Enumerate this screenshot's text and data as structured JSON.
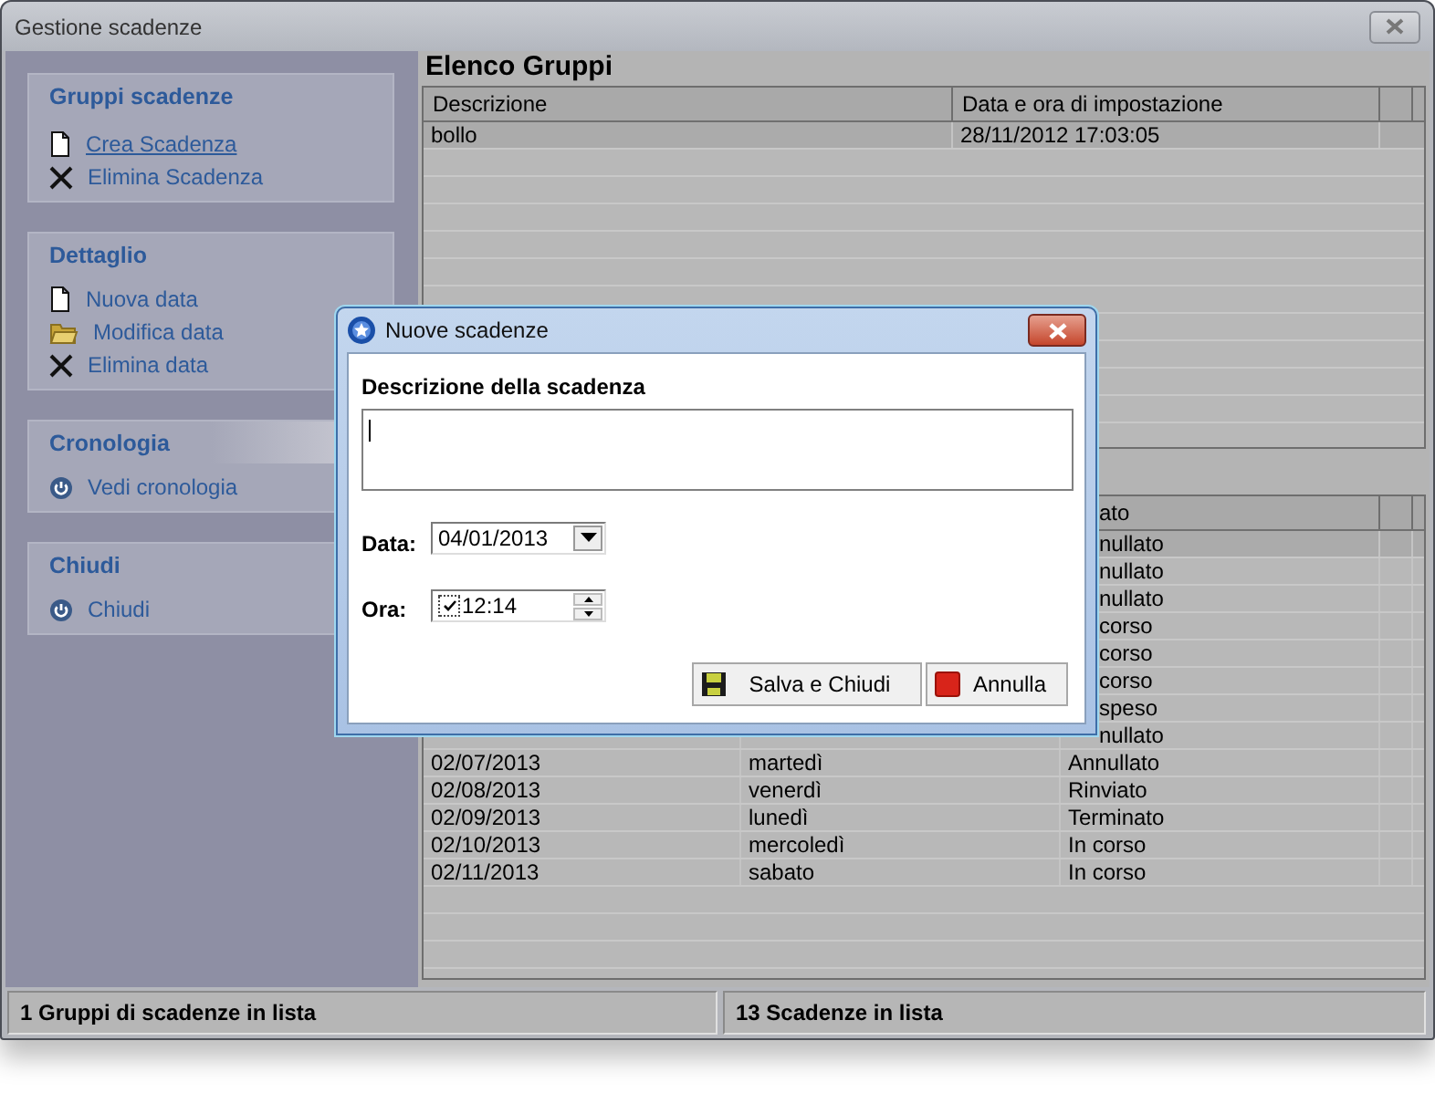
{
  "window": {
    "title": "Gestione scadenze"
  },
  "sidebar": {
    "panels": [
      {
        "title": "Gruppi scadenze",
        "highlighted": false,
        "items": [
          {
            "label": "Crea Scadenza",
            "focused": true
          },
          {
            "label": "Elimina Scadenza",
            "focused": false
          }
        ]
      },
      {
        "title": "Dettaglio",
        "highlighted": false,
        "items": [
          {
            "label": "Nuova data",
            "focused": false
          },
          {
            "label": "Modifica data",
            "focused": false
          },
          {
            "label": "Elimina data",
            "focused": false
          }
        ]
      },
      {
        "title": "Cronologia",
        "highlighted": true,
        "items": [
          {
            "label": "Vedi cronologia",
            "focused": false
          }
        ]
      },
      {
        "title": "Chiudi",
        "highlighted": false,
        "items": [
          {
            "label": "Chiudi",
            "focused": false
          }
        ]
      }
    ]
  },
  "groups": {
    "title": "Elenco Gruppi",
    "columns": [
      "Descrizione",
      "Data e ora di impostazione"
    ],
    "rows": [
      {
        "cells": [
          "bollo",
          "28/11/2012 17:03:05"
        ],
        "selected": true
      }
    ]
  },
  "deadlines": {
    "columns": [
      {
        "kind": "covered"
      },
      {
        "kind": "covered"
      },
      {
        "kind": "partial",
        "label": "ato"
      }
    ],
    "rows": [
      {
        "kind": "partial",
        "status": "nullato",
        "selected": true
      },
      {
        "kind": "partial",
        "status": "nullato",
        "selected": false
      },
      {
        "kind": "partial",
        "status": "nullato",
        "selected": false
      },
      {
        "kind": "partial",
        "status": "corso",
        "selected": false
      },
      {
        "kind": "partial",
        "status": "corso",
        "selected": false
      },
      {
        "kind": "partial",
        "status": "corso",
        "selected": false
      },
      {
        "kind": "partial",
        "status": "speso",
        "selected": false
      },
      {
        "kind": "partial",
        "status": "nullato",
        "selected": false
      },
      {
        "kind": "full",
        "date": "02/07/2013",
        "day": "martedì",
        "status": "Annullato",
        "selected": false
      },
      {
        "kind": "full",
        "date": "02/08/2013",
        "day": "venerdì",
        "status": "Rinviato",
        "selected": false
      },
      {
        "kind": "full",
        "date": "02/09/2013",
        "day": "lunedì",
        "status": "Terminato",
        "selected": false
      },
      {
        "kind": "full",
        "date": "02/10/2013",
        "day": "mercoledì",
        "status": "In corso",
        "selected": false
      },
      {
        "kind": "full",
        "date": "02/11/2013",
        "day": "sabato",
        "status": "In corso",
        "selected": false
      }
    ]
  },
  "dialog": {
    "title": "Nuove scadenze",
    "description_label": "Descrizione della scadenza",
    "date_label": "Data:",
    "date_value": "04/01/2013",
    "time_label": "Ora:",
    "time_value": "12:14",
    "time_checked": true,
    "buttons": [
      {
        "kind": "save",
        "label": "Salva e Chiudi"
      },
      {
        "kind": "cancel",
        "label": "Annulla"
      }
    ]
  },
  "status_bar": [
    "1 Gruppi di scadenze in lista",
    "13 Scadenze in lista"
  ]
}
